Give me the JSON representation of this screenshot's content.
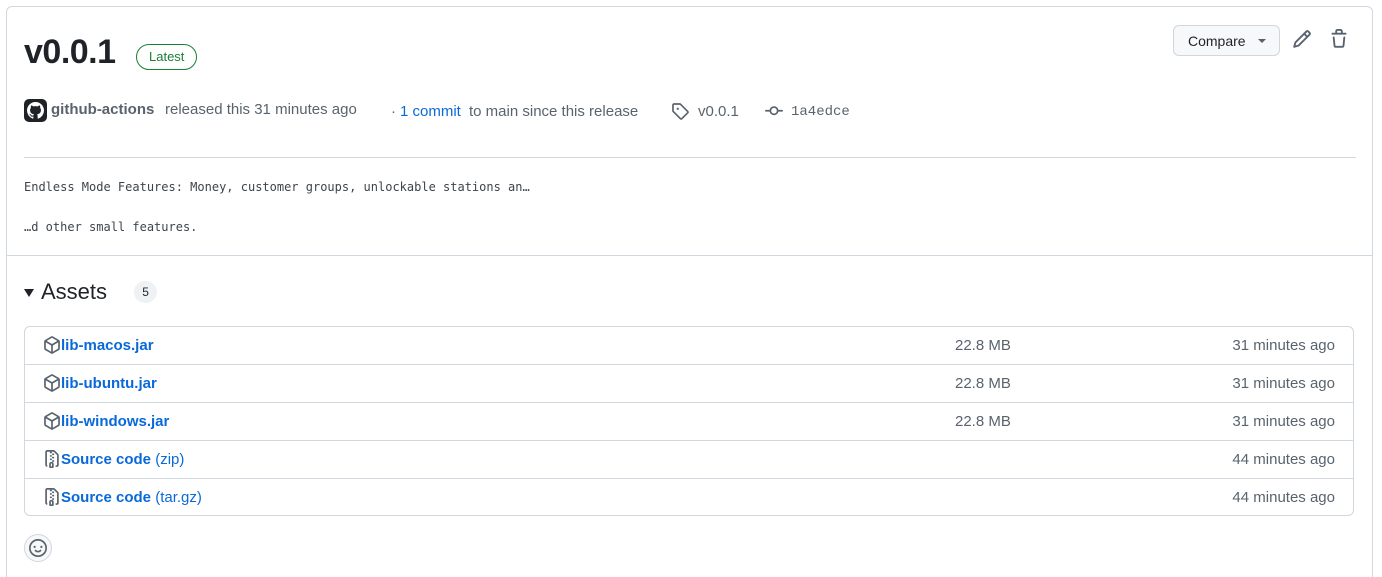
{
  "release": {
    "title": "v0.0.1",
    "badge": "Latest",
    "author": "github-actions",
    "released_text": "released this 31 minutes ago",
    "commit_prefix": "·",
    "commit_link": "1 commit",
    "commit_suffix": "to main since this release",
    "tag": "v0.0.1",
    "commit_sha": "1a4edce"
  },
  "toolbar": {
    "compare_label": "Compare",
    "edit_icon": "pencil-icon",
    "delete_icon": "trash-icon"
  },
  "notes": {
    "line1": "Endless Mode Features: Money, customer groups, unlockable stations an…",
    "line2": "…d other small features."
  },
  "assets": {
    "title": "Assets",
    "count": "5",
    "items": [
      {
        "name": "lib-macos.jar",
        "ext": "",
        "size": "22.8 MB",
        "time": "31 minutes ago",
        "icon": "package-icon"
      },
      {
        "name": "lib-ubuntu.jar",
        "ext": "",
        "size": "22.8 MB",
        "time": "31 minutes ago",
        "icon": "package-icon"
      },
      {
        "name": "lib-windows.jar",
        "ext": "",
        "size": "22.8 MB",
        "time": "31 minutes ago",
        "icon": "package-icon"
      },
      {
        "name": "Source code",
        "ext": "(zip)",
        "size": "",
        "time": "44 minutes ago",
        "icon": "file-zip-icon"
      },
      {
        "name": "Source code",
        "ext": "(tar.gz)",
        "size": "",
        "time": "44 minutes ago",
        "icon": "file-zip-icon"
      }
    ]
  },
  "colors": {
    "link": "#0969da",
    "latest": "#1a7f37",
    "border": "#d0d7de",
    "muted": "#59636e"
  }
}
